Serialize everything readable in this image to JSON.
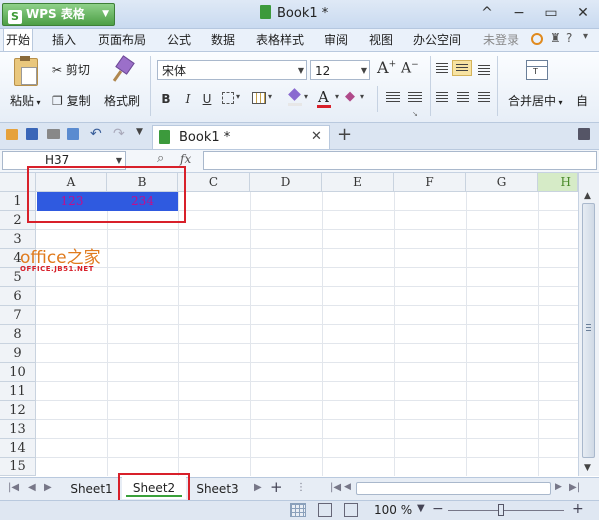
{
  "app": {
    "name": "WPS 表格",
    "doc_title": "Book1 *"
  },
  "window_controls": {
    "minimize": "−",
    "restore": "▭",
    "close": "✕",
    "collapse": "^"
  },
  "menu": [
    "开始",
    "插入",
    "页面布局",
    "公式",
    "数据",
    "表格样式",
    "审阅",
    "视图",
    "办公空间"
  ],
  "account": {
    "login": "未登录"
  },
  "ribbon": {
    "paste": "粘贴",
    "cut": "剪切",
    "copy": "复制",
    "format_painter": "格式刷",
    "font_name": "宋体",
    "font_size": "12",
    "grow": "A",
    "shrink": "A",
    "bold": "B",
    "italic": "I",
    "underline": "U",
    "merge_center": "合并居中",
    "auto": "自"
  },
  "doc_tab": {
    "label": "Book1 *"
  },
  "formula_bar": {
    "name_box": "H37",
    "fx": "fx",
    "formula": ""
  },
  "grid": {
    "columns": [
      "A",
      "B",
      "C",
      "D",
      "E",
      "F",
      "G",
      "H"
    ],
    "rows": [
      "1",
      "2",
      "3",
      "4",
      "5",
      "6",
      "7",
      "8",
      "9",
      "10",
      "11",
      "12",
      "13",
      "14",
      "15"
    ],
    "cells": {
      "A1": "123",
      "B1": "234"
    }
  },
  "watermark": {
    "brand": "office之家",
    "url": "OFFICE.JB51.NET"
  },
  "sheets": [
    "Sheet1",
    "Sheet2",
    "Sheet3"
  ],
  "active_sheet": "Sheet2",
  "status": {
    "zoom": "100 %"
  },
  "colors": {
    "selection": "#2f5ae0",
    "cell_text": "#c0108c",
    "highlight_box": "#d8202a",
    "app_green": "#4c9e45"
  }
}
